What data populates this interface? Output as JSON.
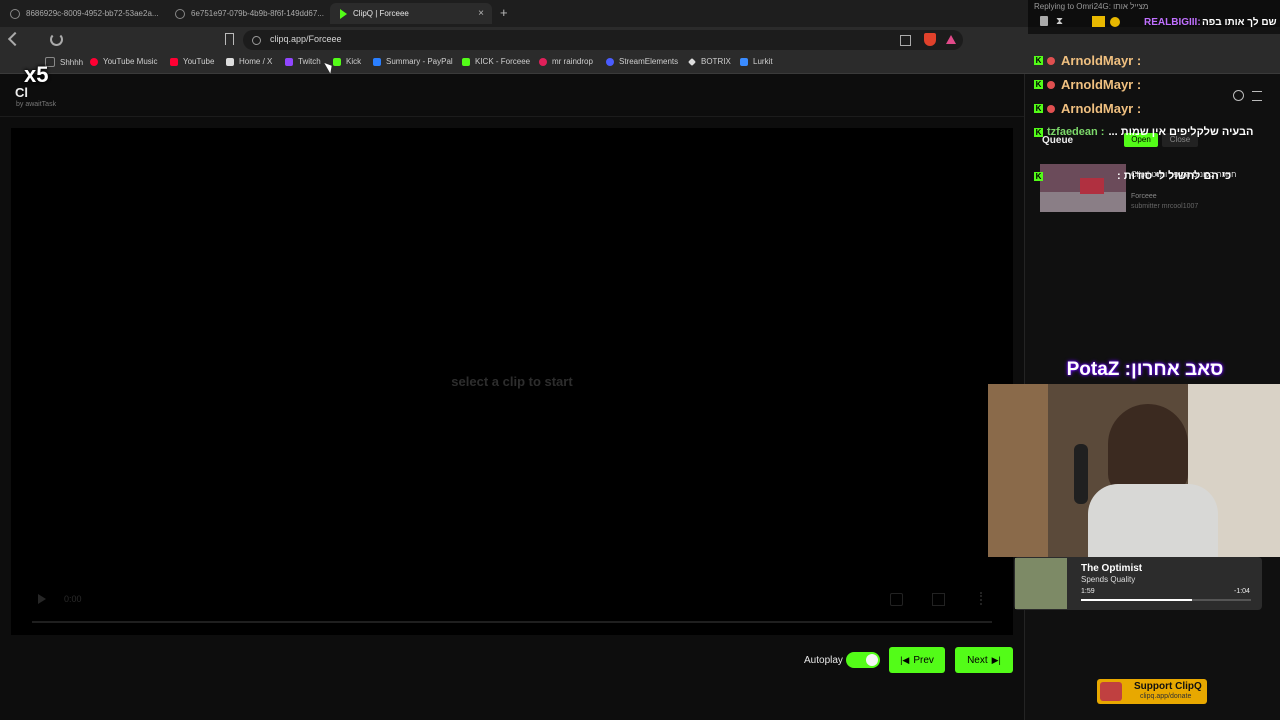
{
  "browser": {
    "tabs": [
      {
        "title": "8686929c-8009-4952-bb72-53ae2a..."
      },
      {
        "title": "6e751e97-079b-4b9b-8f6f-149dd67..."
      },
      {
        "title": "ClipQ | Forceee"
      }
    ],
    "close_glyph": "×",
    "new_tab_glyph": "+",
    "url": "clipq.app/Forceee",
    "bookmarks": [
      {
        "label": "Shhhh",
        "color": "#888888"
      },
      {
        "label": "YouTube Music",
        "color": "#ff0033"
      },
      {
        "label": "YouTube",
        "color": "#ff0033"
      },
      {
        "label": "Home / X",
        "color": "#dddddd"
      },
      {
        "label": "Twitch",
        "color": "#9146ff"
      },
      {
        "label": "Kick",
        "color": "#53fc18"
      },
      {
        "label": "Summary - PayPal",
        "color": "#2a7fff"
      },
      {
        "label": "KICK - Forceee",
        "color": "#53fc18"
      },
      {
        "label": "mr raindrop",
        "color": "#e0205a"
      },
      {
        "label": "StreamElements",
        "color": "#4a5cff"
      },
      {
        "label": "BOTRIX",
        "color": "#dddddd"
      },
      {
        "label": "Lurkit",
        "color": "#3a8bff"
      }
    ]
  },
  "app": {
    "logo": "Cl",
    "byline": "by awaitTask",
    "player_message": "select a clip to start",
    "time": "0:00",
    "autoplay_label": "Autoplay",
    "autoplay_on": true,
    "prev_label": "Prev",
    "next_label": "Next",
    "queue": {
      "title": "Queue",
      "open_label": "Open",
      "close_label": "Close",
      "clip_title": "חנוכה בקונוס הקיפר ותנט | Clip",
      "channel": "Forceee",
      "submitter": "submitter mrcool1007"
    },
    "support_title": "Support ClipQ",
    "support_link": "clipq.app/donate"
  },
  "overlay": {
    "multiplier": "x5",
    "reply_header": "Replying to Omri24G: מצייל אותו",
    "top_message_user": "REALBIGIII:",
    "top_message_text": "שם לך אותו בפה",
    "chat_lines": [
      {
        "user": "ArnoldMayr :",
        "text": ""
      },
      {
        "user": "ArnoldMayr :",
        "text": ""
      },
      {
        "user": "ArnoldMayr :",
        "text": ""
      },
      {
        "user": "tzfaedean :",
        "text": "הבעיה שלקליפים אין שמות ..."
      },
      {
        "user": "",
        "text": "כי הם לחשול לי סודות :"
      }
    ],
    "sub_banner": "סאב אחרון: PotaZ",
    "now_playing": {
      "title": "The Optimist",
      "artist": "Spends Quality",
      "elapsed": "1:59",
      "remaining": "-1:04",
      "progress": 0.65
    }
  }
}
